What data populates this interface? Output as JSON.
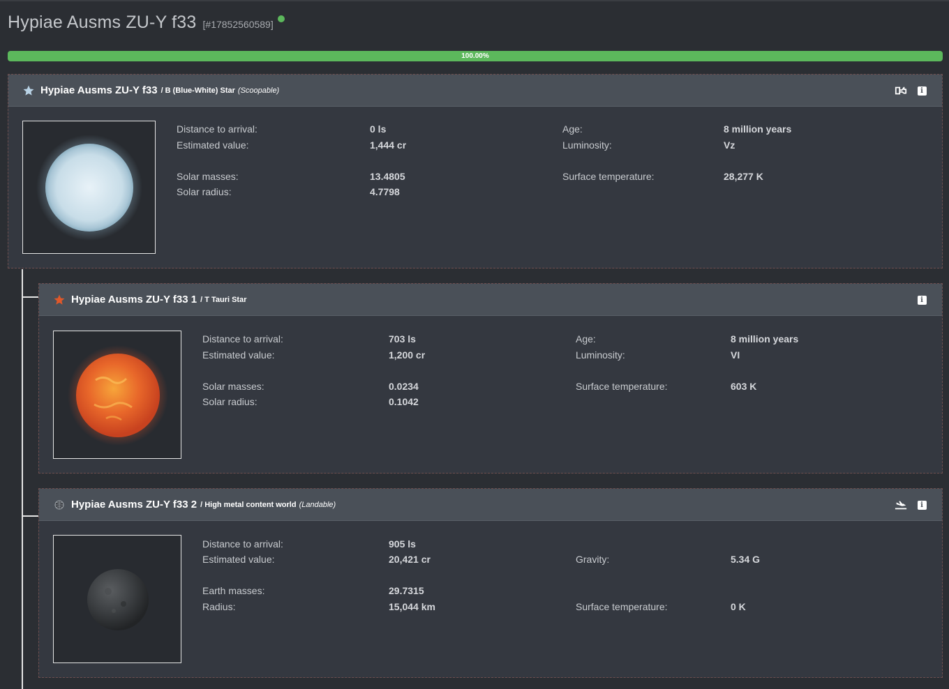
{
  "system": {
    "title": "Hypiae Ausms ZU-Y f33",
    "id": "[#17852560589]",
    "status_color": "#5cb85c"
  },
  "progress": {
    "percent": 100,
    "label": "100.00%"
  },
  "bodies": [
    {
      "name": "Hypiae Ausms ZU-Y f33",
      "subtype": "/ B (Blue-White) Star",
      "note": "(Scoopable)",
      "icon": "star-icon",
      "icon_color": "#b9d3e6",
      "header_actions": [
        "fuel-scoop-icon",
        "info-icon"
      ],
      "image": "blue-white-star",
      "left_rows": [
        {
          "label": "Distance to arrival:",
          "value": "0 ls"
        },
        {
          "label": "Estimated value:",
          "value": "1,444 cr"
        },
        {
          "label": "Solar masses:",
          "value": "13.4805"
        },
        {
          "label": "Solar radius:",
          "value": "4.7798"
        }
      ],
      "right_rows": [
        {
          "label": "Age:",
          "value": "8 million years"
        },
        {
          "label": "Luminosity:",
          "value": "Vz"
        },
        {
          "label": "Surface temperature:",
          "value": "28,277 K"
        }
      ]
    },
    {
      "name": "Hypiae Ausms ZU-Y f33 1",
      "subtype": "/ T Tauri Star",
      "note": "",
      "icon": "star-icon",
      "icon_color": "#e0582a",
      "header_actions": [
        "info-icon"
      ],
      "image": "t-tauri-star",
      "left_rows": [
        {
          "label": "Distance to arrival:",
          "value": "703 ls"
        },
        {
          "label": "Estimated value:",
          "value": "1,200 cr"
        },
        {
          "label": "Solar masses:",
          "value": "0.0234"
        },
        {
          "label": "Solar radius:",
          "value": "0.1042"
        }
      ],
      "right_rows": [
        {
          "label": "Age:",
          "value": "8 million years"
        },
        {
          "label": "Luminosity:",
          "value": "VI"
        },
        {
          "label": "Surface temperature:",
          "value": "603 K"
        }
      ]
    },
    {
      "name": "Hypiae Ausms ZU-Y f33 2",
      "subtype": "/ High metal content world",
      "note": "(Landable)",
      "icon": "globe-icon",
      "icon_color": "#9aa0a6",
      "header_actions": [
        "landing-icon",
        "info-icon"
      ],
      "image": "high-metal-world",
      "left_rows": [
        {
          "label": "Distance to arrival:",
          "value": "905 ls"
        },
        {
          "label": "Estimated value:",
          "value": "20,421 cr"
        },
        {
          "label": "Earth masses:",
          "value": "29.7315"
        },
        {
          "label": "Radius:",
          "value": "15,044 km"
        }
      ],
      "right_rows": [
        {
          "label": "Gravity:",
          "value": "5.34 G"
        },
        {
          "label": "Surface temperature:",
          "value": "0 K"
        }
      ]
    }
  ],
  "info_glyph": "i"
}
